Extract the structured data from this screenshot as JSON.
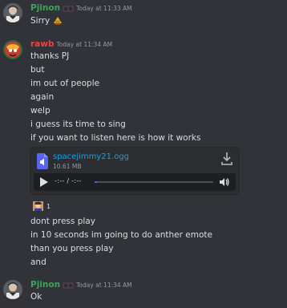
{
  "messages": [
    {
      "author": "Pjinon",
      "author_color": "#3ba55c",
      "timestamp": "Today at 11:33 AM",
      "lines": [
        "Sirry"
      ]
    },
    {
      "author": "rawb",
      "author_color": "#ed4245",
      "timestamp": "Today at 11:34 AM",
      "lines": [
        "thanks PJ",
        "but",
        "im out of people",
        "again",
        "welp",
        "i guess its time to sing",
        "if you want to listen here is how it works"
      ],
      "attachment": {
        "file_name": "spacejimmy21.ogg",
        "file_size": "10.61 MB",
        "time_display": "-:-- / -:--",
        "progress": 0.02,
        "icons": [
          "file-audio-icon",
          "download-icon",
          "play-icon",
          "volume-icon"
        ]
      },
      "reaction": {
        "count": "1"
      },
      "after_lines": [
        "dont press play",
        "in 10 seconds im going to do anther emote",
        "than you press play",
        "and"
      ]
    },
    {
      "author": "Pjinon",
      "author_color": "#3ba55c",
      "timestamp": "Today at 11:34 AM",
      "lines": [
        "Ok"
      ]
    }
  ],
  "colors": {
    "background": "#313338",
    "link": "#00a8fc",
    "muted": "#949ba4",
    "text": "#dbdee1"
  }
}
